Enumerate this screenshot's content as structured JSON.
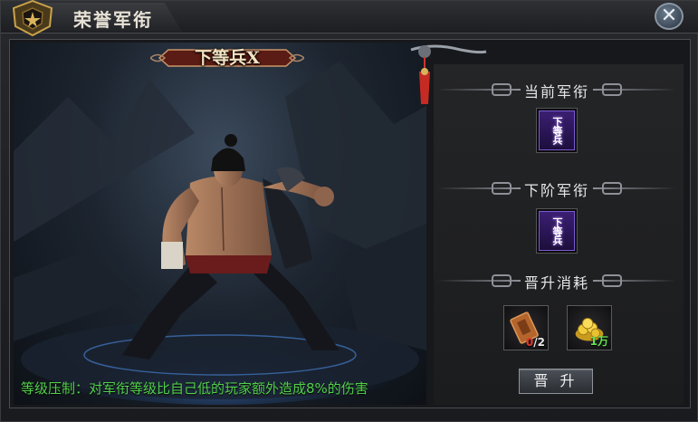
{
  "window": {
    "title": "荣誉军衔"
  },
  "character": {
    "rank_name": "下等兵X"
  },
  "current_rank": {
    "heading": "当前军衔",
    "badge_text": "下等兵"
  },
  "next_rank": {
    "heading": "下阶军衔",
    "badge_text": "下等兵"
  },
  "promotion_cost": {
    "heading": "晋升消耗",
    "items": [
      {
        "icon": "token-tablet-icon",
        "have": "0",
        "need": "/2"
      },
      {
        "icon": "gold-coins-icon",
        "amount": "1万"
      }
    ]
  },
  "promote_button": {
    "label": "晋 升"
  },
  "bonus_text": "等级压制：对军衔等级比自己低的玩家额外造成8%的伤害",
  "colors": {
    "accent_green": "#52d04a",
    "badge_purple": "#3b1e73",
    "count_red": "#e23a2a"
  }
}
